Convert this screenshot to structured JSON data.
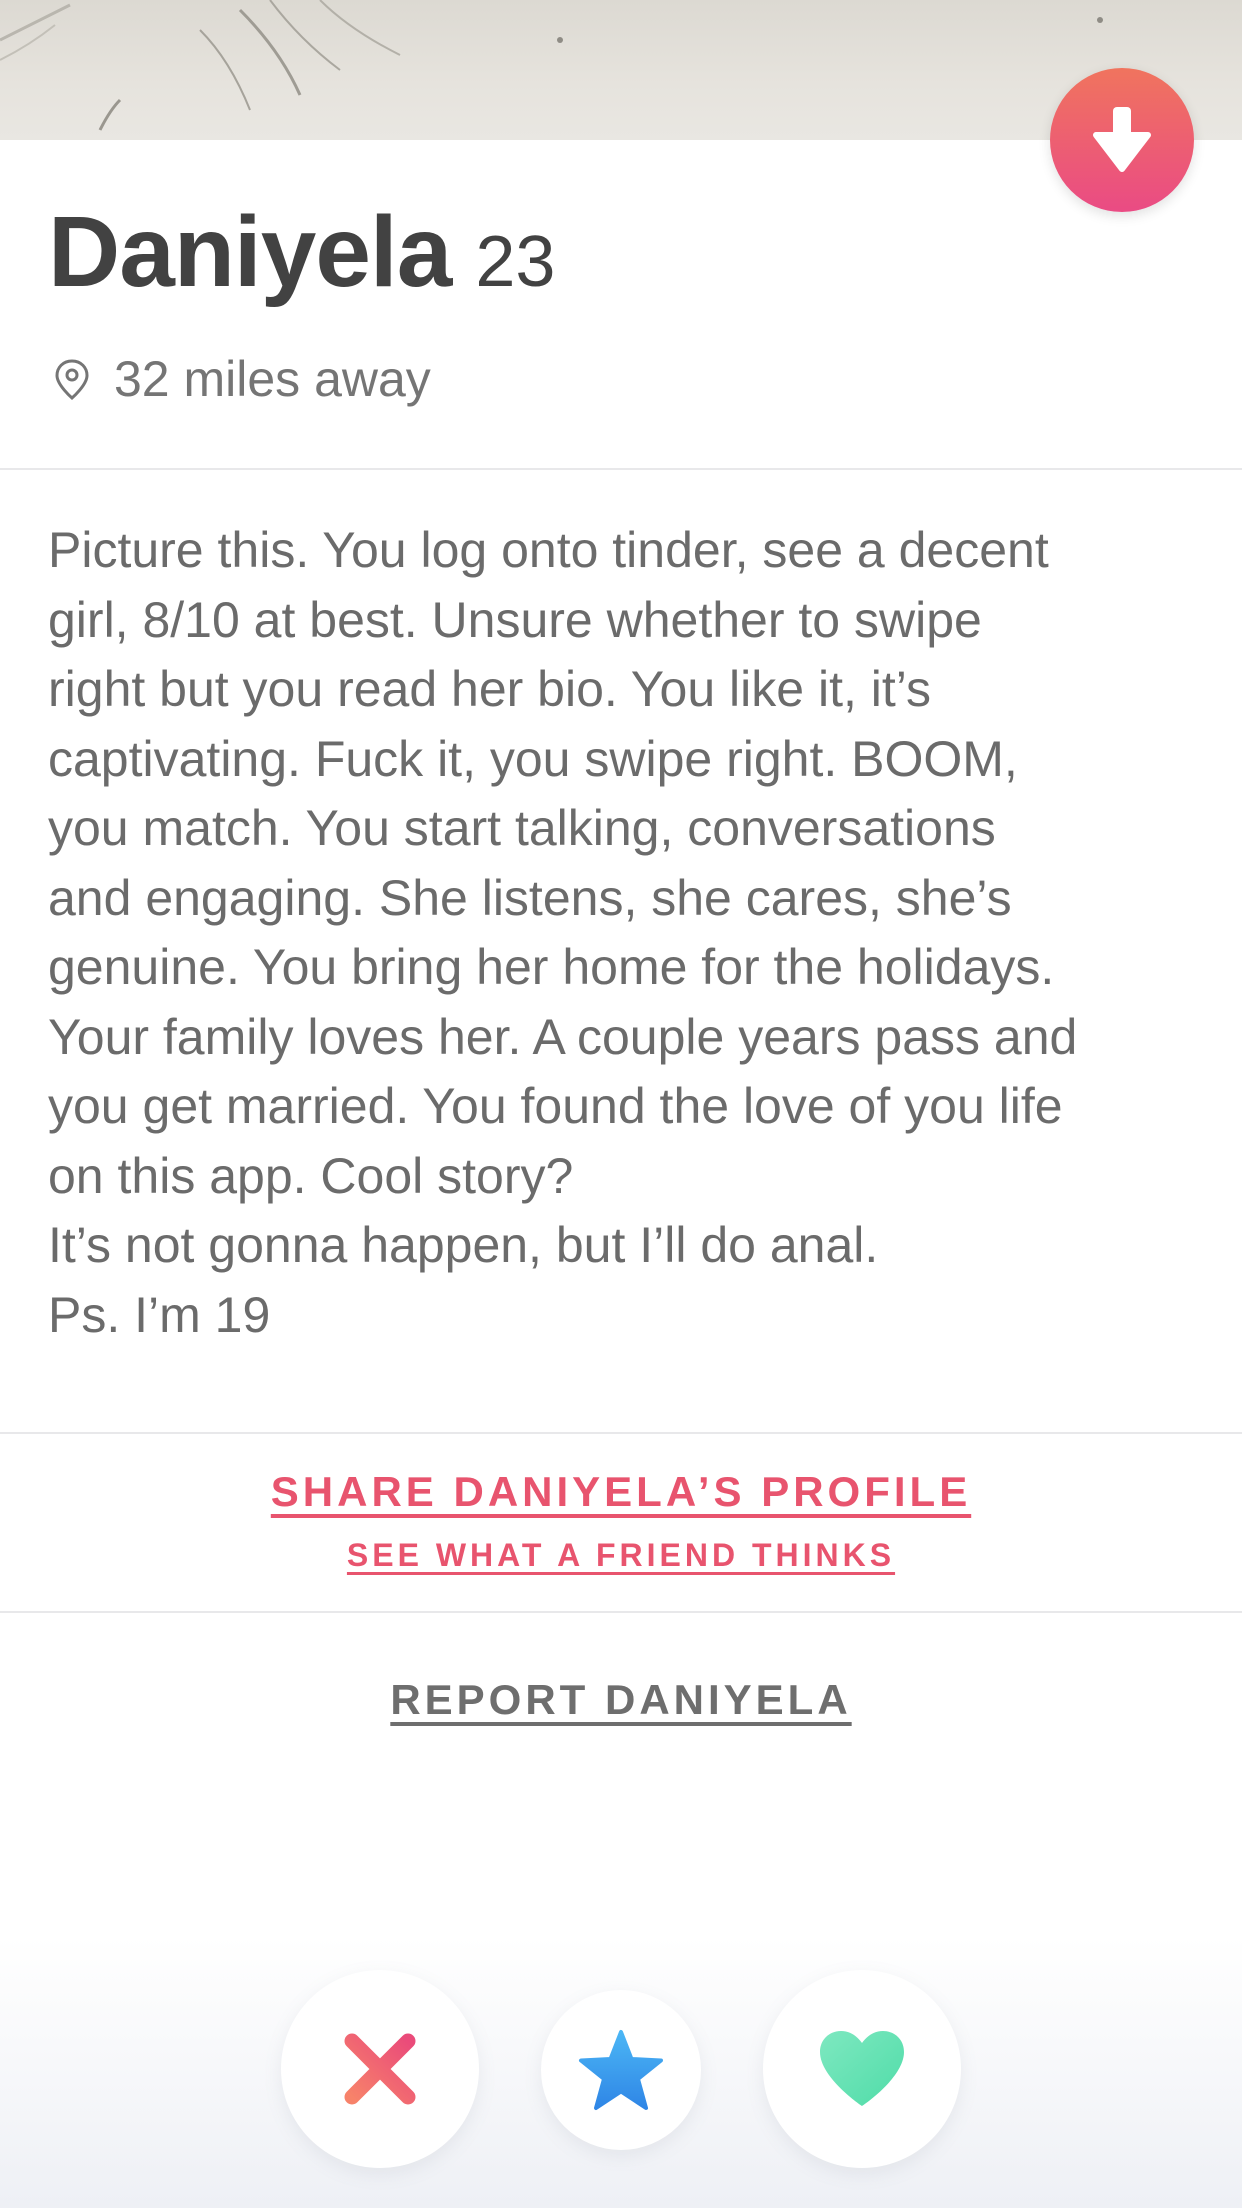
{
  "profile": {
    "name": "Daniyela",
    "age": "23",
    "distance": "32 miles away"
  },
  "bio": {
    "lines": [
      "Picture this. You log onto tinder, see a decent",
      "girl, 8/10 at best. Unsure whether to swipe",
      "right but you read her bio. You like it, it’s",
      "captivating. Fuck it, you swipe right. BOOM,",
      "you match. You start talking, conversations",
      "and engaging.  She listens, she cares, she’s",
      "genuine. You bring her home for the holidays.",
      "Your family loves her. A couple years pass and",
      "you get married. You found the love of you life",
      "on this app. Cool story?",
      "It’s not gonna happen, but I’ll do anal.",
      "Ps. I’m 19"
    ]
  },
  "links": {
    "share": "SHARE DANIYELA’S PROFILE",
    "share_sub": "SEE WHAT A FRIEND THINKS",
    "report": "REPORT DANIYELA"
  },
  "icons": {
    "collapse": "arrow-down-icon",
    "location": "location-pin-icon",
    "nope": "x-icon",
    "super_like": "star-icon",
    "like": "heart-icon"
  },
  "colors": {
    "accent": "#e8546e",
    "collapse_top": "#f0745e",
    "collapse_bottom": "#ea4b84",
    "nope": "#ef5d6b",
    "super_like": "#3b9ff0",
    "like": "#5fe3b5"
  }
}
